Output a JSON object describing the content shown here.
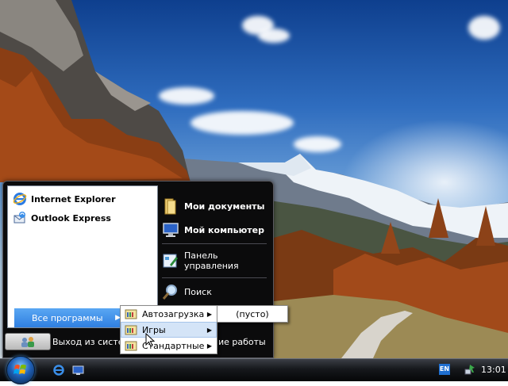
{
  "start_menu": {
    "pinned": [
      {
        "label": "Internet Explorer",
        "icon": "ie-icon"
      },
      {
        "label": "Outlook Express",
        "icon": "outlook-icon"
      }
    ],
    "all_programs_label": "Все программы",
    "right_column": [
      {
        "label": "Мои документы",
        "icon": "folder-icon",
        "bold": true
      },
      {
        "label": "Мой компьютер",
        "icon": "computer-icon",
        "bold": true
      },
      {
        "label_line1": "Панель",
        "label_line2": "управления",
        "icon": "control-panel-icon"
      },
      {
        "label": "Поиск",
        "icon": "search-icon"
      }
    ],
    "logoff_text": "Выход из системы",
    "shutdown_text": "ение работы"
  },
  "programs_submenu": {
    "items": [
      {
        "label": "Автозагрузка",
        "has_arrow": true
      },
      {
        "label": "Игры",
        "has_arrow": true,
        "highlighted": true
      },
      {
        "label": "Стандартные",
        "has_arrow": true
      }
    ]
  },
  "startup_submenu": {
    "items": [
      {
        "label": "(пусто)"
      }
    ]
  },
  "taskbar": {
    "language": "EN",
    "clock": "13:01"
  },
  "colors": {
    "accent": "#2f7fe0",
    "menu_bg": "#0b0b0c",
    "highlight": "#d4e4f7"
  }
}
